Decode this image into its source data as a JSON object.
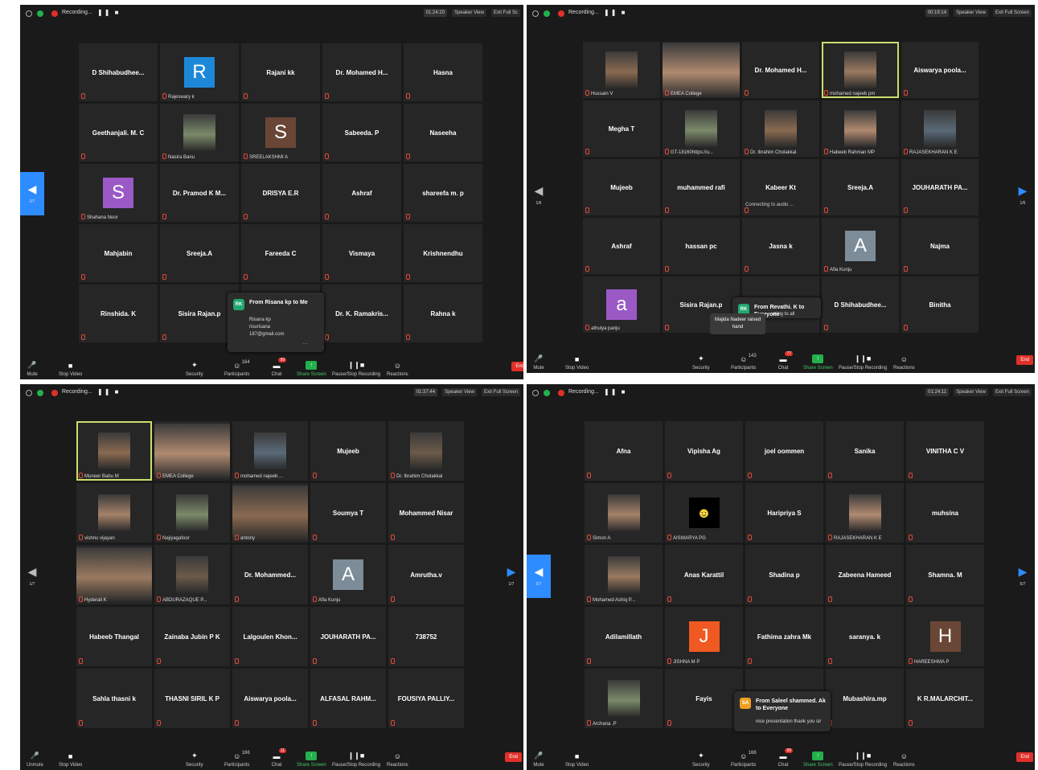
{
  "toolbar_labels": {
    "mute": "Mute",
    "unmute": "Unmute",
    "stop_video": "Stop Video",
    "security": "Security",
    "participants": "Participants",
    "chat": "Chat",
    "share_screen": "Share Screen",
    "recording": "Pause/Stop Recording",
    "reactions": "Reactions",
    "end": "End"
  },
  "recording_label": "Recording...",
  "speaker_view": "Speaker View",
  "exit_full_screen": "Exit Full Screen",
  "colors": {
    "share_green": "#22b14c",
    "end_red": "#e0302a",
    "active_speaker": "#c8e06a",
    "page_arrow_blue": "#2d8cff",
    "tile_bg": "#262626"
  },
  "quads": [
    {
      "timer": "01:24:20",
      "exit_label": "Exit Full Sc",
      "page": "2/7",
      "participants_count": "164",
      "chat_badge": "99",
      "mute_label": "Mute",
      "cols": 5,
      "tiles": [
        {
          "type": "name",
          "name": "D Shihabudhee..."
        },
        {
          "type": "avatar",
          "letter": "R",
          "color": "#1e88d8",
          "label": "Rajeswary k"
        },
        {
          "type": "name",
          "name": "Rajani kk"
        },
        {
          "type": "name",
          "name": "Dr. Mohamed H..."
        },
        {
          "type": "name",
          "name": "Hasna"
        },
        {
          "type": "name",
          "name": "Geethanjali. M. C"
        },
        {
          "type": "photo",
          "label": "Nasira Banu"
        },
        {
          "type": "avatar",
          "letter": "S",
          "color": "#6a4636",
          "label": "SREELAKSHMI A"
        },
        {
          "type": "name",
          "name": "Sabeeda. P"
        },
        {
          "type": "name",
          "name": "Naseeha"
        },
        {
          "type": "avatar",
          "letter": "S",
          "color": "#9b59c6",
          "label": "Shahana Noor"
        },
        {
          "type": "name",
          "name": "Dr. Pramod K M..."
        },
        {
          "type": "name",
          "name": "DRISYA E.R"
        },
        {
          "type": "name",
          "name": "Ashraf"
        },
        {
          "type": "name",
          "name": "shareefa m. p"
        },
        {
          "type": "name",
          "name": "Mahjabin"
        },
        {
          "type": "name",
          "name": "Sreeja.A"
        },
        {
          "type": "name",
          "name": "Fareeda C"
        },
        {
          "type": "name",
          "name": "Vismaya"
        },
        {
          "type": "name",
          "name": "Krishnendhu"
        },
        {
          "type": "name",
          "name": "Rinshida. K"
        },
        {
          "type": "name",
          "name": "Sisira Rajan.p"
        },
        {
          "type": "name",
          "name": ""
        },
        {
          "type": "name",
          "name": "Dr. K. Ramakris..."
        },
        {
          "type": "name",
          "name": "Rahna k"
        }
      ],
      "chat_popup": {
        "initials": "RK",
        "from": "From Risana kp to Me",
        "message": "Risana kp\nrisurisana\n187@gmail.com"
      }
    },
    {
      "timer": "00:19:14",
      "exit_label": "Exit Full Screen",
      "page": "1/6",
      "page_right": "1/6",
      "participants_count": "143",
      "chat_badge": "77",
      "mute_label": "Mute",
      "cols": 5,
      "tiles": [
        {
          "type": "photo",
          "label": "Hussain V"
        },
        {
          "type": "widephoto",
          "label": "EMEA College"
        },
        {
          "type": "name",
          "name": "Dr. Mohamed H..."
        },
        {
          "type": "photo",
          "label": "mohamed najeeb pm",
          "highlight": true
        },
        {
          "type": "name",
          "name": "Aiswarya poola..."
        },
        {
          "type": "name",
          "name": "Megha T"
        },
        {
          "type": "photo",
          "label": "GT-18160https://u..."
        },
        {
          "type": "photo",
          "label": "Dr. Ibrahim Cholakkal"
        },
        {
          "type": "photo",
          "label": "Habeeb Rahman MP"
        },
        {
          "type": "photo",
          "label": "RAJASEKHARAN K E"
        },
        {
          "type": "name",
          "name": "Mujeeb"
        },
        {
          "type": "name",
          "name": "muhammed rafi"
        },
        {
          "type": "name",
          "name": "Kabeer Kt",
          "status": "Connecting to audio ..."
        },
        {
          "type": "name",
          "name": "Sreeja.A"
        },
        {
          "type": "name",
          "name": "JOUHARATH PA..."
        },
        {
          "type": "name",
          "name": "Ashraf"
        },
        {
          "type": "name",
          "name": "hassan pc"
        },
        {
          "type": "name",
          "name": "Jasna k"
        },
        {
          "type": "avatar",
          "letter": "A",
          "color": "#7c8c98",
          "label": "Afla Kunju"
        },
        {
          "type": "name",
          "name": "Najma"
        },
        {
          "type": "avatar",
          "letter": "a",
          "color": "#9b59c6",
          "label": "athulya panju"
        },
        {
          "type": "name",
          "name": "Sisira Rajan.p"
        },
        {
          "type": "name",
          "name": ""
        },
        {
          "type": "name",
          "name": "D Shihabudhee..."
        },
        {
          "type": "name",
          "name": "Binitha"
        }
      ],
      "chat_popup": {
        "initials": "RK",
        "from": "From Revathi. K to Everyone",
        "message": "ming to all"
      },
      "hand_popup": "Majida Nadeer raised\nhand"
    },
    {
      "timer": "01:37:44",
      "exit_label": "Exit Full Screen",
      "page": "1/7",
      "page_right": "1/7",
      "participants_count": "166",
      "chat_badge": "11",
      "mute_label": "Unmute",
      "cols": 5,
      "tiles": [
        {
          "type": "photo",
          "label": "Muneer Babu M",
          "highlight": true
        },
        {
          "type": "widephoto",
          "label": "EMEA College"
        },
        {
          "type": "photo",
          "label": "mohamed najeeb ..."
        },
        {
          "type": "name",
          "name": "Mujeeb"
        },
        {
          "type": "photo",
          "label": "Dr. Ibrahim Cholakkal"
        },
        {
          "type": "photo",
          "label": "vishnu vijayan"
        },
        {
          "type": "photo",
          "label": "Najiyagafoor"
        },
        {
          "type": "widephoto",
          "label": "antony"
        },
        {
          "type": "name",
          "name": "Soumya T"
        },
        {
          "type": "name",
          "name": "Mohammed Nisar"
        },
        {
          "type": "widephoto",
          "label": "Hyderali K"
        },
        {
          "type": "photo",
          "label": "ABDURAZAQUE P..."
        },
        {
          "type": "name",
          "name": "Dr. Mohammed..."
        },
        {
          "type": "avatar",
          "letter": "A",
          "color": "#7c8c98",
          "label": "Afla Kunju"
        },
        {
          "type": "name",
          "name": "Amrutha.v"
        },
        {
          "type": "name",
          "name": "Habeeb Thangal"
        },
        {
          "type": "name",
          "name": "Zainaba Jubin P K"
        },
        {
          "type": "name",
          "name": "Lalgoulen Khon..."
        },
        {
          "type": "name",
          "name": "JOUHARATH PA..."
        },
        {
          "type": "name",
          "name": "738752"
        },
        {
          "type": "name",
          "name": "Sahla thasni k"
        },
        {
          "type": "name",
          "name": "THASNI SIRIL K P"
        },
        {
          "type": "name",
          "name": "Aiswarya poola..."
        },
        {
          "type": "name",
          "name": "ALFASAL RAHM..."
        },
        {
          "type": "name",
          "name": "FOUSIYA PALLIY..."
        }
      ]
    },
    {
      "timer": "01:24:11",
      "exit_label": "Exit Full Screen",
      "page": "5/7",
      "page_right": "5/7",
      "participants_count": "166",
      "chat_badge": "99",
      "mute_label": "Mute",
      "cols": 5,
      "tiles": [
        {
          "type": "name",
          "name": "Afna"
        },
        {
          "type": "name",
          "name": "Vipisha Ag"
        },
        {
          "type": "name",
          "name": "joel oommen"
        },
        {
          "type": "name",
          "name": "Sanika"
        },
        {
          "type": "name",
          "name": "VINITHA C V"
        },
        {
          "type": "photo",
          "label": "Simon A"
        },
        {
          "type": "emoji",
          "label": "AISWARYA PG"
        },
        {
          "type": "name",
          "name": "Haripriya S"
        },
        {
          "type": "photo",
          "label": "RAJASEKHARAN K E"
        },
        {
          "type": "name",
          "name": "muhsina"
        },
        {
          "type": "photo",
          "label": "Mohamed Ashiq P..."
        },
        {
          "type": "name",
          "name": "Anas Karattil"
        },
        {
          "type": "name",
          "name": "Shadina p"
        },
        {
          "type": "name",
          "name": "Zabeena Hameed"
        },
        {
          "type": "name",
          "name": "Shamna. M"
        },
        {
          "type": "name",
          "name": "Adilamillath"
        },
        {
          "type": "avatar",
          "letter": "J",
          "color": "#f05a22",
          "label": "JISHNA M P"
        },
        {
          "type": "name",
          "name": "Fathima zahra Mk"
        },
        {
          "type": "name",
          "name": "saranya. k"
        },
        {
          "type": "avatar",
          "letter": "H",
          "color": "#6a4636",
          "label": "HAREESHMA P"
        },
        {
          "type": "photo",
          "label": "Archana .P"
        },
        {
          "type": "name",
          "name": "Fayis"
        },
        {
          "type": "name",
          "name": ""
        },
        {
          "type": "name",
          "name": "Mubashira.mp"
        },
        {
          "type": "name",
          "name": "K R.MALARCHIT..."
        }
      ],
      "chat_popup": {
        "initials": "SA",
        "from": "From Saleel shammed. Ak to Everyone",
        "message": "nice presentation thank you sir"
      }
    }
  ]
}
